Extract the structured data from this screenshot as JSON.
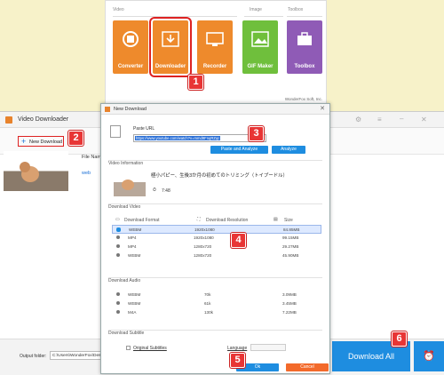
{
  "launcher": {
    "sections": {
      "video": "Video",
      "image": "Image",
      "toolbox": "Toolbox"
    },
    "tiles": [
      {
        "label": "Converter",
        "color": "#ee8a2c"
      },
      {
        "label": "Downloader",
        "color": "#ee8a2c"
      },
      {
        "label": "Recorder",
        "color": "#ee8a2c"
      },
      {
        "label": "GIF Maker",
        "color": "#6fbf3c"
      },
      {
        "label": "Toolbox",
        "color": "#8f5bb6"
      }
    ],
    "footer": "WonderFox Soft, Inc."
  },
  "downloader": {
    "title": "Video Downloader",
    "new_download": "New Download",
    "file_name_label": "File Nam",
    "file_name_value": "web",
    "output_label": "Output folder:",
    "output_path": "C:\\Users\\WonderFox\\Desk",
    "download_all": "Download All"
  },
  "dialog": {
    "title": "New Download",
    "paste_url_label": "Paste URL",
    "url_value": "https://www.youtube.com/watch?v=mmd9FnqRZqc",
    "paste_analyze": "Paste and Analyze",
    "analyze": "Analyze",
    "video_info_label": "Video Information",
    "video_title": "極小パピー、生後3か月の初めてのトリミング（トイプードル）",
    "duration": "7:48",
    "download_video_label": "Download Video",
    "video_headers": {
      "format": "Download Format",
      "resolution": "Download Resolution",
      "size": "Size"
    },
    "video_rows": [
      {
        "format": "WEBM",
        "res": "1920x1080",
        "size": "84.85MB",
        "selected": true
      },
      {
        "format": "MP4",
        "res": "1920x1080",
        "size": "99.15MB",
        "selected": false
      },
      {
        "format": "MP4",
        "res": "1280x720",
        "size": "29.27MB",
        "selected": false
      },
      {
        "format": "WEBM",
        "res": "1280x720",
        "size": "45.90MB",
        "selected": false
      }
    ],
    "download_audio_label": "Download Audio",
    "audio_rows": [
      {
        "format": "WEBM",
        "res": "70k",
        "size": "3.09MB"
      },
      {
        "format": "WEBM",
        "res": "61k",
        "size": "3.45MB"
      },
      {
        "format": "M4A",
        "res": "130k",
        "size": "7.22MB"
      }
    ],
    "download_subtitle_label": "Download Subtitle",
    "original_subtitles": "Original Subtitles",
    "language_label": "Language",
    "ok": "Ok",
    "cancel": "Cancel"
  },
  "badges": [
    "1",
    "2",
    "3",
    "4",
    "5",
    "6"
  ]
}
